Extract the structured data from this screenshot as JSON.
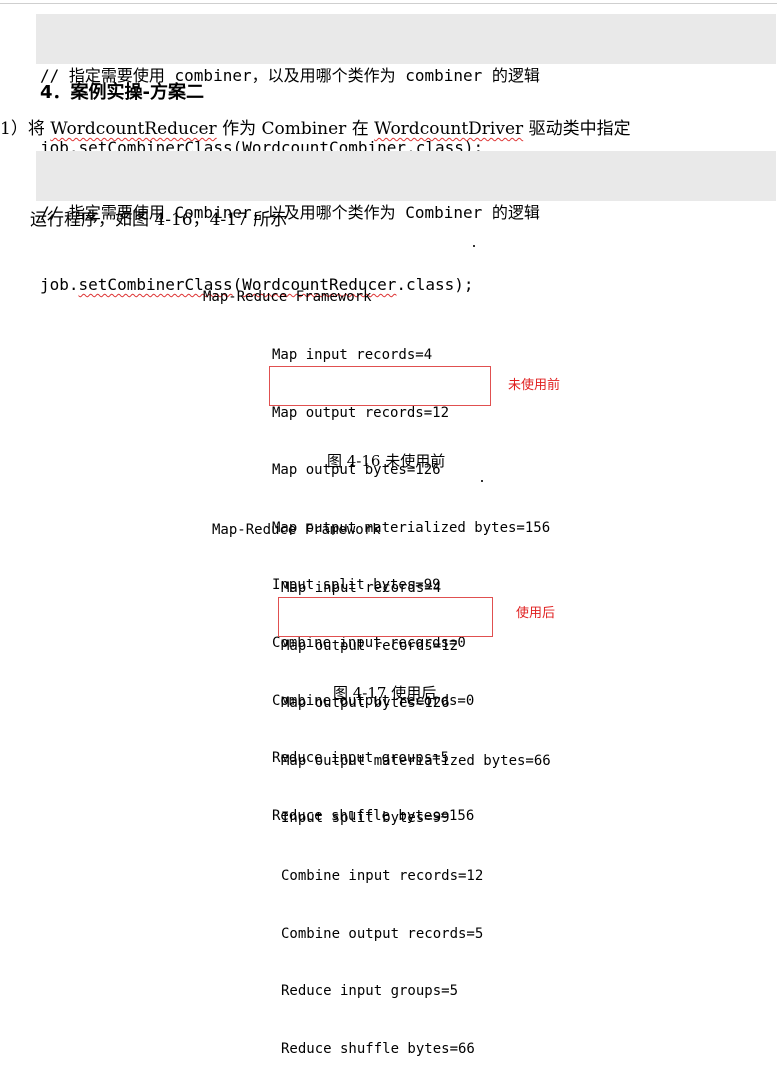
{
  "code1": {
    "line1": "// 指定需要使用 combiner，以及用哪个类作为 combiner 的逻辑",
    "line2_prefix": "job.",
    "line2_method": "setCombinerClass",
    "line2_paren": "(",
    "line2_class": "WordcountCombiner",
    "line2_suffix": ".class);"
  },
  "heading": "4．案例实操-方案二",
  "para1": {
    "prefix": "1）将 ",
    "reducer": "WordcountReducer",
    "mid1": " 作为 Combiner 在 ",
    "driver": "WordcountDriver",
    "suffix": " 驱动类中指定"
  },
  "code2": {
    "line1": "// 指定需要使用 Combiner，以及用哪个类作为 Combiner 的逻辑",
    "line2_prefix": "job.",
    "line2_method": "setCombinerClass",
    "line2_paren": "(",
    "line2_class": "WordcountReducer",
    "line2_suffix": ".class);"
  },
  "para2": "运行程序，如图 4-16，4-17 所示",
  "figure1": {
    "title": "Map-Reduce Framework",
    "lines": [
      "Map input records=4",
      "Map output records=12",
      "Map output bytes=126",
      "Map output materialized bytes=156",
      "Input split bytes=99",
      "Combine input records=0",
      "Combine output records=0",
      "Reduce input groups=5",
      "Reduce shuffle bytes=156"
    ],
    "note": "未使用前",
    "caption": "图 4-16  未使用前"
  },
  "figure2": {
    "title": "Map-Reduce Framework",
    "lines": [
      "Map input records=4",
      "Map output records=12",
      "Map output bytes=126",
      "Map output materialized bytes=66",
      "Input split bytes=99",
      "Combine input records=12",
      "Combine output records=5",
      "Reduce input groups=5",
      "Reduce shuffle bytes=66"
    ],
    "note": "使用后",
    "caption": "图 4-17  使用后"
  }
}
